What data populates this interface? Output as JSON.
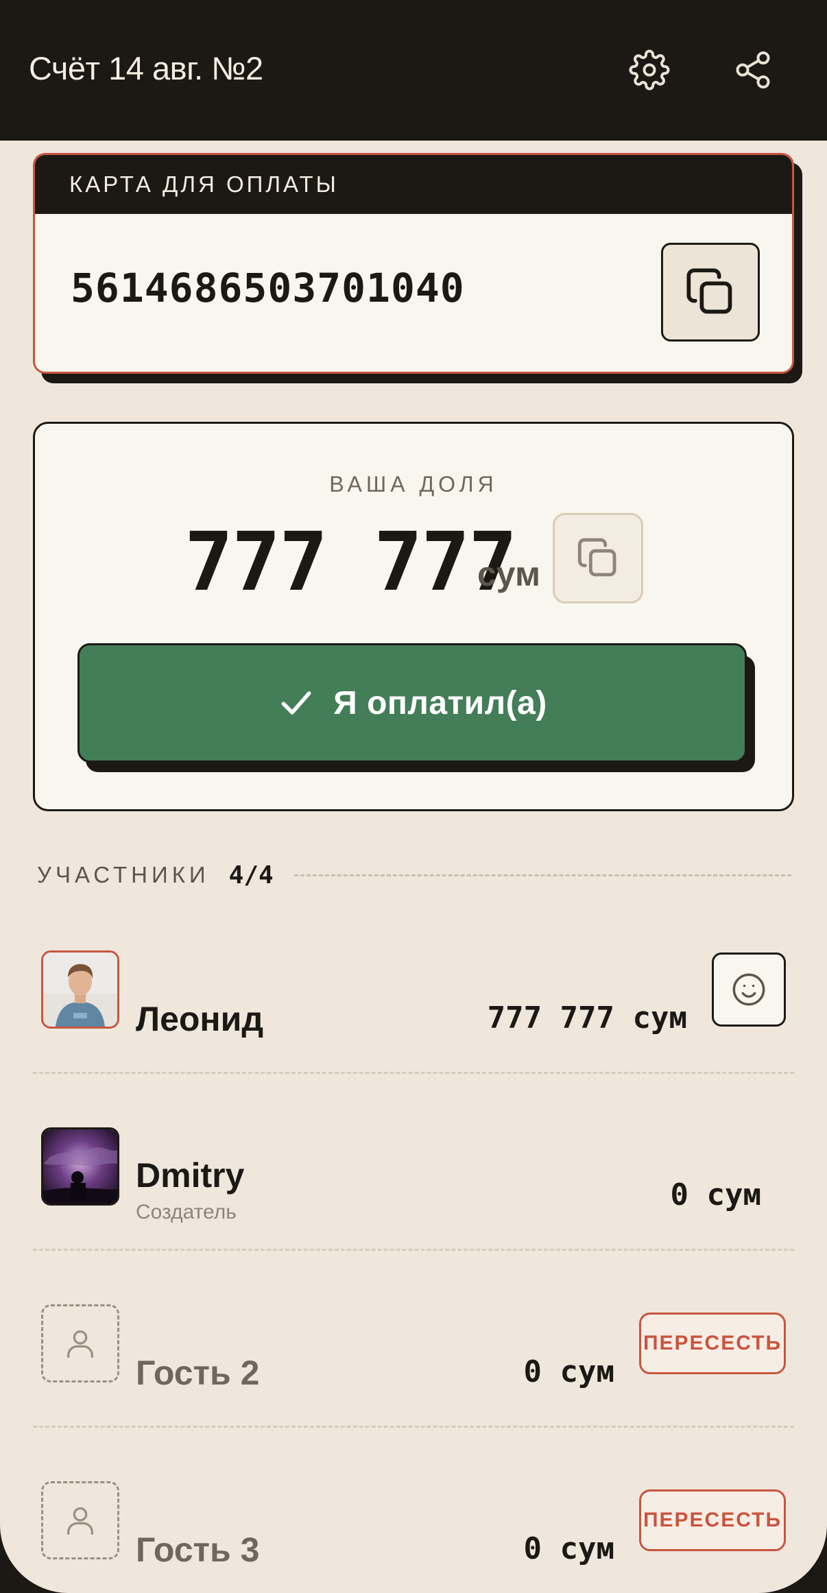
{
  "header": {
    "title": "Счёт 14 авг. №2",
    "settings_icon": "gear-icon",
    "share_icon": "share-icon"
  },
  "payment_card": {
    "heading": "КАРТА ДЛЯ ОПЛАТЫ",
    "number": "5614686503701040",
    "copy_icon": "copy-icon"
  },
  "your_share": {
    "label": "ВАША ДОЛЯ",
    "amount": "777 777",
    "currency": "сум",
    "copy_icon": "copy-icon",
    "pay_button_label": "Я оплатил(а)",
    "pay_button_icon": "check-icon"
  },
  "participants": {
    "title": "УЧАСТНИКИ",
    "count": "4/4",
    "items": [
      {
        "name": "Леонид",
        "subtitle": "",
        "amount": "777 777 сум",
        "action": "smile-icon"
      },
      {
        "name": "Dmitry",
        "subtitle": "Создатель",
        "amount": "0 сум",
        "action": ""
      },
      {
        "name": "Гость 2",
        "subtitle": "",
        "amount": "0 сум",
        "action_label": "ПЕРЕСЕСТЬ"
      },
      {
        "name": "Гость 3",
        "subtitle": "",
        "amount": "0 сум",
        "action_label": "ПЕРЕСЕСТЬ"
      }
    ]
  },
  "colors": {
    "dark": "#1c1915",
    "background": "#efe7dc",
    "accent_red": "#c9553f",
    "pay_green": "#437e58"
  }
}
